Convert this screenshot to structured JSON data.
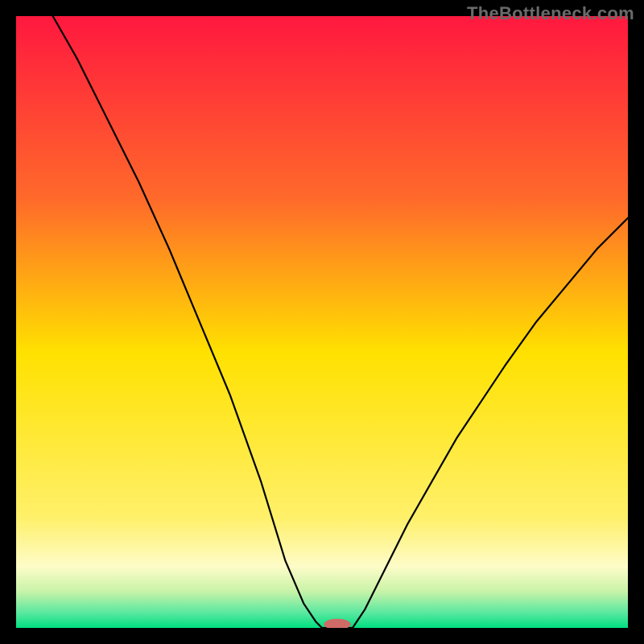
{
  "watermark": "TheBottleneck.com",
  "colors": {
    "frame_bg": "#000000",
    "gradient_top": "#ff183f",
    "gradient_mid_upper": "#ff8a2a",
    "gradient_mid": "#ffe100",
    "gradient_lower": "#fff8b0",
    "gradient_band": "#d0f7a0",
    "gradient_bottom": "#00e080",
    "curve_stroke": "#000000",
    "marker_fill": "#cf6b66"
  },
  "chart_data": {
    "type": "line",
    "title": "",
    "xlabel": "",
    "ylabel": "",
    "xlim": [
      0,
      100
    ],
    "ylim": [
      0,
      100
    ],
    "series": [
      {
        "name": "bottleneck-curve-left",
        "x": [
          6,
          10,
          15,
          20,
          25,
          30,
          35,
          40,
          44,
          47,
          49,
          50
        ],
        "y": [
          100,
          93,
          83,
          73,
          62,
          50,
          38,
          24,
          11,
          4,
          1,
          0
        ]
      },
      {
        "name": "bottleneck-curve-right",
        "x": [
          55,
          57,
          60,
          64,
          68,
          72,
          76,
          80,
          85,
          90,
          95,
          100
        ],
        "y": [
          0,
          3,
          9,
          17,
          24,
          31,
          37,
          43,
          50,
          56,
          62,
          67
        ]
      }
    ],
    "flat_segment": {
      "x": [
        50,
        55
      ],
      "y": 0
    },
    "marker": {
      "x": 52.5,
      "y": 0.6,
      "rx": 2.2,
      "ry": 0.9
    },
    "gradient_stops": [
      {
        "offset": 0.0,
        "color": "#ff183f"
      },
      {
        "offset": 0.3,
        "color": "#ff6a2a"
      },
      {
        "offset": 0.55,
        "color": "#ffe100"
      },
      {
        "offset": 0.82,
        "color": "#fff06a"
      },
      {
        "offset": 0.9,
        "color": "#fdfcc8"
      },
      {
        "offset": 0.94,
        "color": "#c9f3a8"
      },
      {
        "offset": 0.975,
        "color": "#5be8a0"
      },
      {
        "offset": 1.0,
        "color": "#00df80"
      }
    ]
  }
}
